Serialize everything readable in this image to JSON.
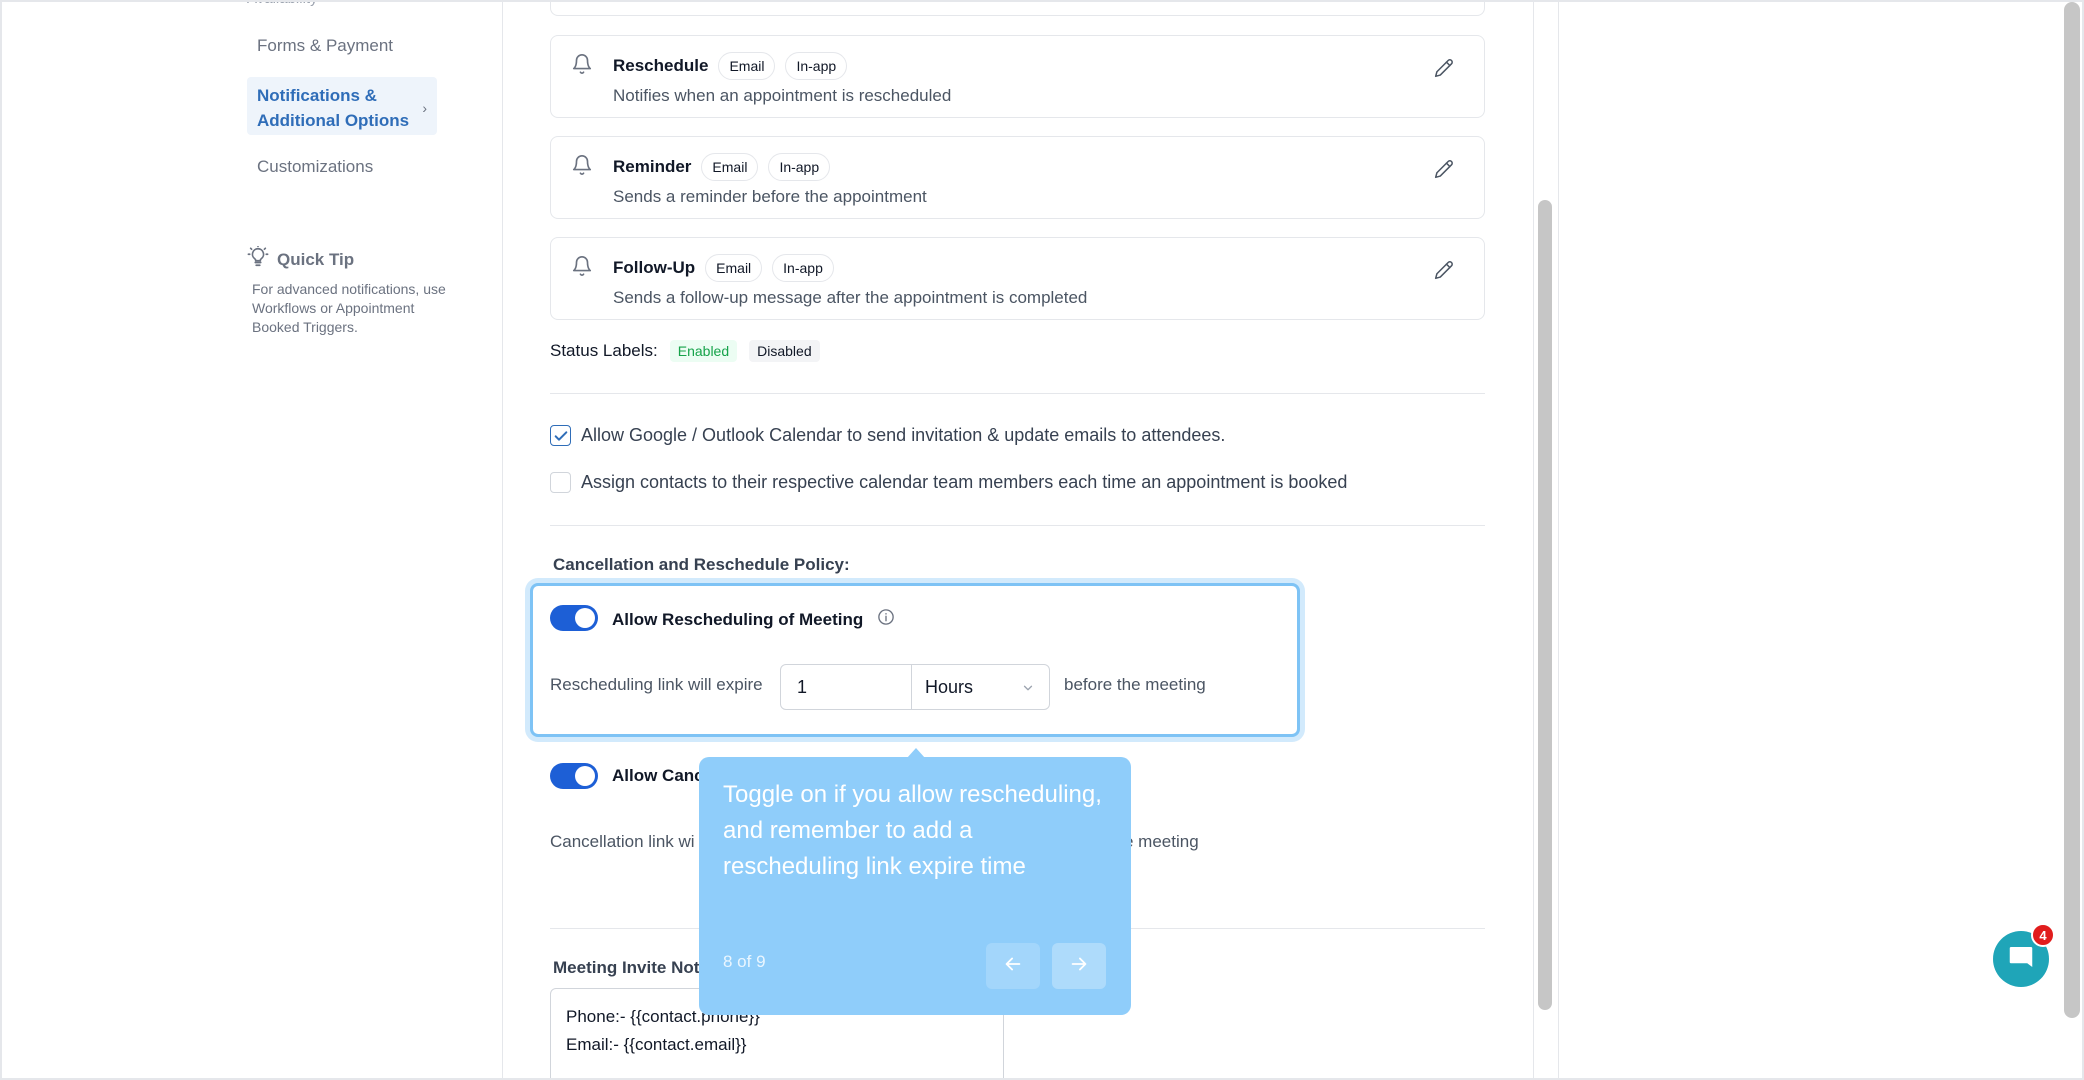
{
  "nav": {
    "items": [
      {
        "label": "Forms & Payment"
      },
      {
        "label": "Notifications & Additional Options"
      },
      {
        "label": "Customizations"
      }
    ],
    "quick_tip": {
      "title": "Quick Tip",
      "body": "For advanced notifications, use Workflows or Appointment Booked Triggers."
    }
  },
  "notifications": [
    {
      "title": "Reschedule",
      "channels": [
        "Email",
        "In-app"
      ],
      "description": "Notifies when an appointment is rescheduled"
    },
    {
      "title": "Reminder",
      "channels": [
        "Email",
        "In-app"
      ],
      "description": "Sends a reminder before the appointment"
    },
    {
      "title": "Follow-Up",
      "channels": [
        "Email",
        "In-app"
      ],
      "description": "Sends a follow-up message after the appointment is completed"
    }
  ],
  "status_labels": {
    "label": "Status Labels:",
    "enabled": "Enabled",
    "disabled": "Disabled"
  },
  "options": {
    "calendar_invites": {
      "label": "Allow Google / Outlook Calendar to send invitation & update emails to attendees.",
      "checked": true
    },
    "assign_contacts": {
      "label": "Assign contacts to their respective calendar team members each time an appointment is booked",
      "checked": false
    }
  },
  "policy": {
    "heading": "Cancellation and Reschedule Policy:",
    "reschedule": {
      "label": "Allow Rescheduling of Meeting",
      "enabled": true,
      "expire_prefix": "Rescheduling link will expire",
      "value": "1",
      "unit": "Hours",
      "expire_suffix": "before the meeting"
    },
    "cancel": {
      "label_visible": "Allow Canc",
      "enabled": true,
      "expire_prefix_visible": "Cancellation link wi",
      "expire_suffix_visible": "e meeting"
    }
  },
  "meeting_notes": {
    "label_visible": "Meeting Invite Note",
    "lines": [
      "Phone:- {{contact.phone}}",
      "Email:- {{contact.email}}"
    ]
  },
  "tooltip": {
    "message": "Toggle on if you allow rescheduling, and remember to add a rescheduling link expire time",
    "step": "8 of 9"
  },
  "chat": {
    "badge_count": "4"
  },
  "colors": {
    "accent": "#2f6db8",
    "toggle": "#1d5fd6",
    "tooltip_bg": "#8fcdfa",
    "enabled_green": "#16a34a",
    "chat_bg": "#1fa5b8"
  }
}
